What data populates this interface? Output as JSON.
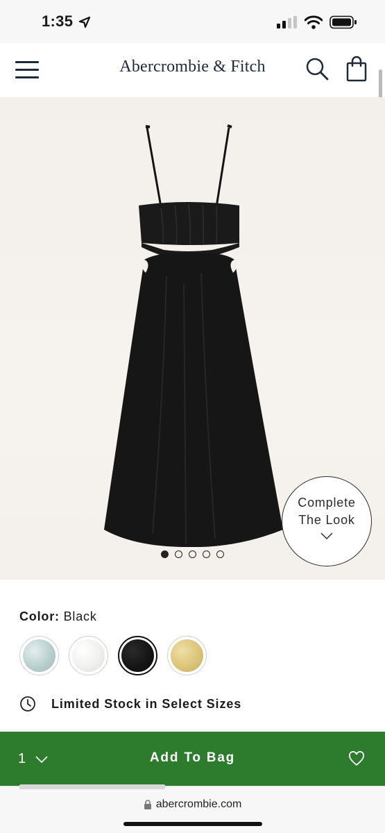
{
  "status": {
    "time": "1:35"
  },
  "header": {
    "brand": "Abercrombie & Fitch",
    "menu_icon": "hamburger-menu-icon",
    "search_icon": "search-icon",
    "bag_icon": "shopping-bag-icon"
  },
  "gallery": {
    "image_count": 5,
    "active_index": 0,
    "complete_look_line1": "Complete",
    "complete_look_line2": "The Look"
  },
  "product": {
    "color_label": "Color:",
    "color_value": "Black",
    "swatches": [
      {
        "name": "light blue",
        "color": "#b8cfcf",
        "selected": false
      },
      {
        "name": "white",
        "color": "#f2f2f0",
        "selected": false
      },
      {
        "name": "black",
        "color": "#141414",
        "selected": true
      },
      {
        "name": "yellow",
        "color": "#dcc57a",
        "selected": false
      }
    ],
    "stock_text": "Limited Stock in Select Sizes"
  },
  "add_bar": {
    "quantity": "1",
    "button_label": "Add To Bag",
    "bar_color": "#2d7c2e"
  },
  "browser": {
    "url": "abercrombie.com"
  }
}
